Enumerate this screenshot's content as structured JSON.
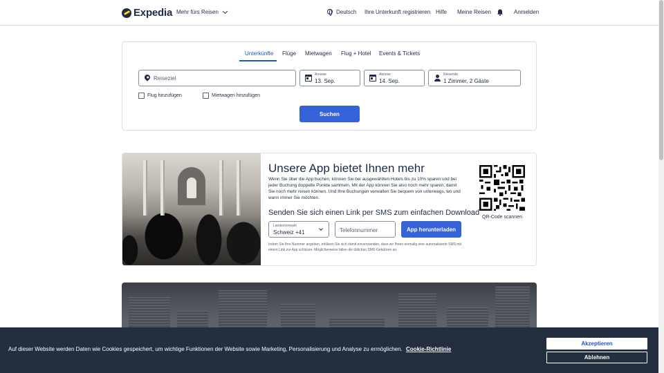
{
  "header": {
    "logo_text": "Expedia",
    "more_travel": "Mehr fürs Reisen",
    "language": "Deutsch",
    "register_property": "Ihre Unterkunft registrieren",
    "help": "Hilfe",
    "my_trips": "Meine Reisen",
    "sign_in": "Anmelden"
  },
  "search": {
    "tabs": [
      {
        "label": "Unterkünfte",
        "active": true
      },
      {
        "label": "Flüge",
        "active": false
      },
      {
        "label": "Mietwagen",
        "active": false
      },
      {
        "label": "Flug + Hotel",
        "active": false
      },
      {
        "label": "Events & Tickets",
        "active": false
      }
    ],
    "destination_placeholder": "Reiseziel",
    "checkin": {
      "label": "Anreise",
      "value": "13. Sep."
    },
    "checkout": {
      "label": "Abreise",
      "value": "14. Sep."
    },
    "travelers": {
      "label": "Reisende",
      "value": "1 Zimmer, 2 Gäste"
    },
    "add_flight": "Flug hinzufügen",
    "add_car": "Mietwagen hinzufügen",
    "submit": "Suchen"
  },
  "app_promo": {
    "title": "Unsere App bietet Ihnen mehr",
    "description": "Wenn Sie über die App buchen, können Sie bei ausgewählten Hotels bis zu 10% sparen und bei jeder Buchung doppelte Punkte sammeln. Mit der App können Sie also noch mehr sparen, damit Sie noch mehr reisen können. Und Ihre Buchungen verwalten Sie bequem von unterwegs, wo und wann immer Sie möchten.",
    "sms_title": "Senden Sie sich einen Link per SMS zum einfachen Download",
    "country_label": "Landesvorwahl",
    "country_value": "Schweiz +41",
    "phone_placeholder": "Telefonnummer",
    "download_button": "App herunterladen",
    "legal": "Indem Sie Ihre Nummer angeben, erklären Sie sich damit einverstanden, dass wir Ihnen einmalig eine automatisierte SMS mit einem Link zur App schicken. Möglicherweise fallen die üblichen SMS-Gebühren an.",
    "qr_label": "QR-Code scannen"
  },
  "cookie": {
    "text": "Auf dieser Website werden Daten wie Cookies gespeichert, um wichtige Funktionen der Website sowie Marketing, Personalisierung und Analyse zu ermöglichen.",
    "policy_link": "Cookie-Richtlinie",
    "accept": "Akzeptieren",
    "reject": "Ablehnen"
  },
  "colors": {
    "brand_navy": "#1f2b49",
    "primary_blue": "#3662d8",
    "active_tab": "#1f55c7",
    "cookie_bar": "#232f3e"
  }
}
